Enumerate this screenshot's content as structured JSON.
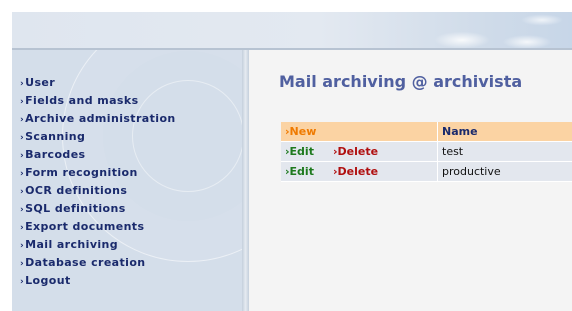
{
  "sidebar": {
    "items": [
      {
        "label": "User"
      },
      {
        "label": "Fields and masks"
      },
      {
        "label": "Archive administration"
      },
      {
        "label": "Scanning"
      },
      {
        "label": "Barcodes"
      },
      {
        "label": "Form recognition"
      },
      {
        "label": "OCR definitions"
      },
      {
        "label": "SQL definitions"
      },
      {
        "label": "Export documents"
      },
      {
        "label": "Mail archiving"
      },
      {
        "label": "Database creation"
      },
      {
        "label": "Logout"
      }
    ],
    "arrow": "›"
  },
  "main": {
    "title": "Mail archiving @ archivista",
    "table": {
      "new_label": "New",
      "name_header": "Name",
      "rows": [
        {
          "edit_label": "Edit",
          "delete_label": "Delete",
          "name": "test"
        },
        {
          "edit_label": "Edit",
          "delete_label": "Delete",
          "name": "productive"
        }
      ]
    }
  },
  "colors": {
    "menu_text": "#1a2a6c",
    "title": "#5060a0",
    "header_row": "#fbd3a3",
    "new_link": "#ef7a00",
    "edit_link": "#1f7a1f",
    "delete_link": "#b01010"
  }
}
